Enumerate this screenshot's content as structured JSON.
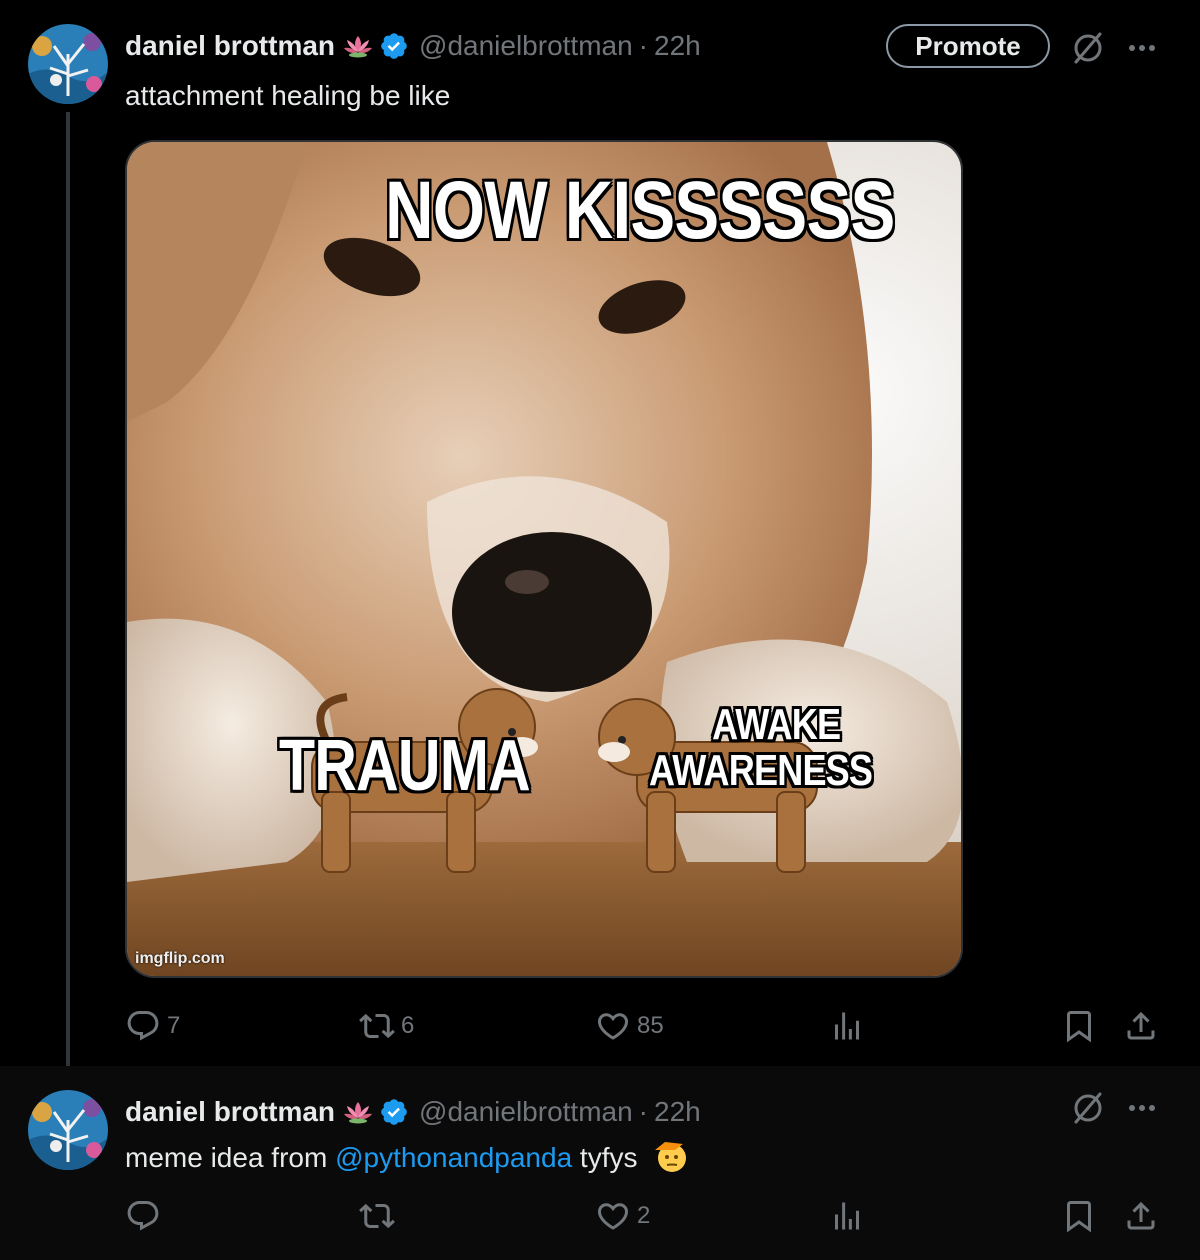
{
  "tweets": [
    {
      "author": {
        "name": "daniel brottman",
        "handle": "@danielbrottman",
        "time": "22h"
      },
      "text": "attachment healing be like",
      "promote_label": "Promote",
      "media": {
        "top_caption": "NOW KISSSSSS",
        "left_caption": "TRAUMA",
        "right_caption_line1": "AWAKE",
        "right_caption_line2": "AWARENESS",
        "watermark": "imgflip.com"
      },
      "stats": {
        "replies": "7",
        "reposts": "6",
        "likes": "85"
      }
    },
    {
      "author": {
        "name": "daniel brottman",
        "handle": "@danielbrottman",
        "time": "22h"
      },
      "text_before": "meme idea from ",
      "mention": "@pythonandpanda",
      "text_after": " tyfys",
      "stats": {
        "replies": "",
        "reposts": "",
        "likes": "2"
      }
    }
  ],
  "colors": {
    "accent": "#1d9bf0",
    "muted": "#71767b",
    "text": "#e7e9ea",
    "background": "#000000"
  },
  "icons": [
    "lotus-icon",
    "verified-icon",
    "grok-icon",
    "more-icon",
    "reply-icon",
    "repost-icon",
    "like-icon",
    "views-icon",
    "bookmark-icon",
    "share-icon",
    "saluting-face-emoji"
  ]
}
